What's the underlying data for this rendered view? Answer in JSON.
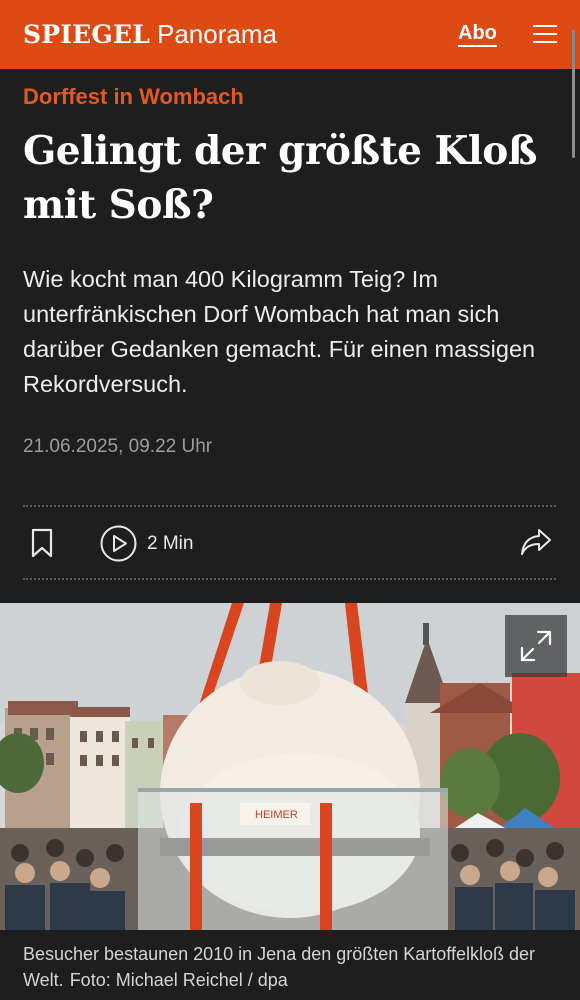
{
  "header": {
    "logo": "SPIEGEL",
    "section": "Panorama",
    "abo_label": "Abo",
    "menu_icon": "hamburger-menu-icon",
    "background_color": "#dd4a14"
  },
  "article": {
    "kicker": "Dorffest in Wombach",
    "headline": "Gelingt der größte Kloß mit Soß?",
    "teaser": "Wie kocht man 400 Kilogramm Teig? Im unterfränkischen Dorf Wombach hat man sich darüber Gedanken gemacht. Für einen massigen Rekordversuch.",
    "date": "21.06.2025, 09.22 Uhr",
    "kicker_color": "#e25a23"
  },
  "actions": {
    "bookmark_icon": "bookmark-icon",
    "play_icon": "play-icon",
    "duration": "2 Min",
    "share_icon": "share-icon"
  },
  "image": {
    "expand_icon": "expand-icon",
    "caption": "Besucher bestaunen 2010 in Jena den größten Kartoffelkloß der Welt.",
    "credit": "Foto: Michael Reichel / dpa"
  }
}
